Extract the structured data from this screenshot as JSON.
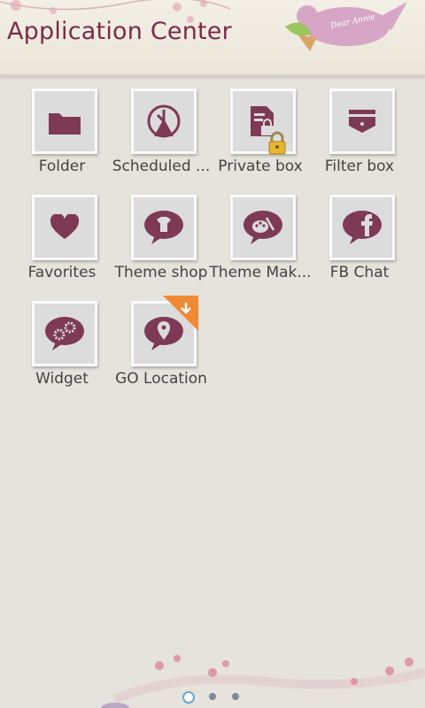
{
  "header": {
    "title": "Application Center",
    "bird_text": "Dear Annie"
  },
  "colors": {
    "accent": "#7a2b4c",
    "icon": "#7e3a55",
    "tile_bg": "#dcdcdc"
  },
  "apps": [
    {
      "label": "Folder",
      "icon": "folder-icon"
    },
    {
      "label": "Scheduled ...",
      "icon": "schedule-icon"
    },
    {
      "label": "Private box",
      "icon": "private-box-icon",
      "badge": "lock"
    },
    {
      "label": "Filter box",
      "icon": "filter-box-icon"
    },
    {
      "label": "Favorites",
      "icon": "heart-icon"
    },
    {
      "label": "Theme shop",
      "icon": "theme-shop-icon"
    },
    {
      "label": "Theme Mak...",
      "icon": "theme-maker-icon"
    },
    {
      "label": "FB Chat",
      "icon": "fb-chat-icon"
    },
    {
      "label": "Widget",
      "icon": "widget-icon"
    },
    {
      "label": "GO Location",
      "icon": "location-icon",
      "badge": "download"
    }
  ],
  "pager": {
    "pages": 3,
    "current": 1
  }
}
